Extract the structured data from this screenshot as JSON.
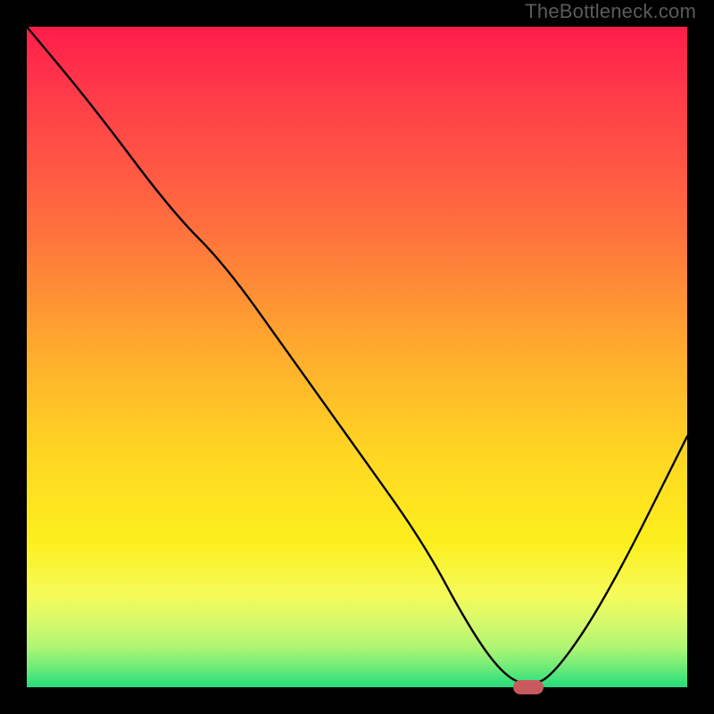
{
  "watermark": "TheBottleneck.com",
  "chart_data": {
    "type": "line",
    "title": "",
    "xlabel": "",
    "ylabel": "",
    "xlim": [
      0,
      100
    ],
    "ylim": [
      0,
      100
    ],
    "grid": false,
    "series": [
      {
        "name": "bottleneck-curve",
        "x": [
          0,
          10,
          22,
          30,
          40,
          50,
          60,
          67,
          72,
          76,
          80,
          88,
          100
        ],
        "values": [
          100,
          88,
          72,
          64,
          50,
          36,
          22,
          9,
          2,
          0,
          2,
          14,
          38
        ]
      }
    ],
    "marker": {
      "x": 76,
      "y": 0,
      "name": "optimal-point"
    },
    "background_gradient": {
      "stops": [
        {
          "pos": 0,
          "color": "#ff1d4a"
        },
        {
          "pos": 50,
          "color": "#ffae2d"
        },
        {
          "pos": 80,
          "color": "#fcef1e"
        },
        {
          "pos": 100,
          "color": "#24dc7e"
        }
      ]
    }
  }
}
